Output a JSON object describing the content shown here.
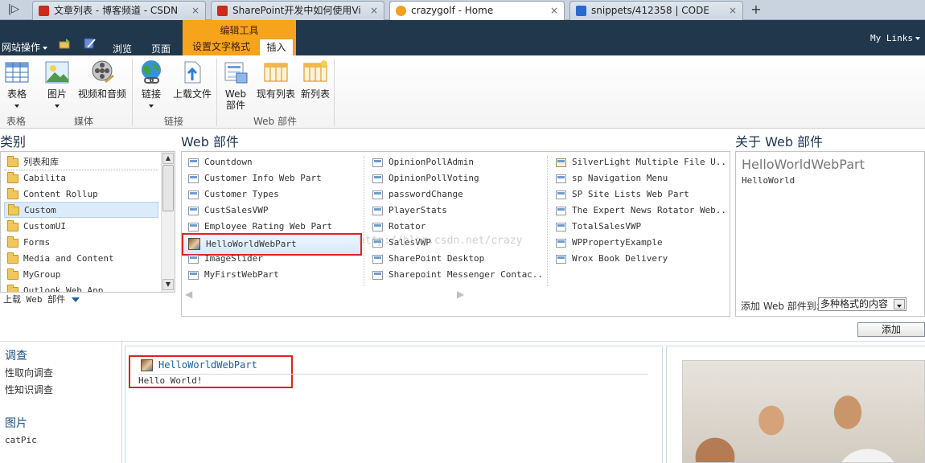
{
  "browser": {
    "tabs": [
      {
        "title": "文章列表 - 博客频道 - CSDN",
        "color": "#cc2a1a"
      },
      {
        "title": "SharePoint开发中如何使用Vi",
        "color": "#cc2a1a"
      },
      {
        "title": "crazygolf - Home",
        "color": "#f0a020"
      },
      {
        "title": "snippets/412358 | CODE",
        "color": "#2a6ad0"
      }
    ],
    "new_tab": "+",
    "close_glyph": "×"
  },
  "ribbon": {
    "site_actions": "网站操作",
    "browse": "浏览",
    "page": "页面",
    "context_group": "编辑工具",
    "tab_format": "设置文字格式",
    "tab_insert": "插入",
    "my_links": "My Links",
    "buttons": {
      "table": "表格",
      "picture": "图片",
      "video_audio": "视频和音频",
      "link": "链接",
      "upload_file": "上载文件",
      "web_part": "Web 部件",
      "existing_list": "现有列表",
      "new_list": "新列表"
    },
    "groups": {
      "tables": "表格",
      "media": "媒体",
      "links": "链接",
      "web_parts": "Web 部件"
    }
  },
  "categories": {
    "heading": "类别",
    "items": [
      "列表和库",
      "Cabilita",
      "Content Rollup",
      "Custom",
      "CustomUI",
      "Forms",
      "Media and Content",
      "MyGroup",
      "Outlook Web App"
    ],
    "selected": "Custom",
    "upload": "上载 Web 部件"
  },
  "webparts": {
    "heading": "Web 部件",
    "columns": [
      [
        "Countdown",
        "Customer Info Web Part",
        "Customer Types",
        "CustSalesVWP",
        "Employee Rating Web Part",
        "HelloWorldWebPart",
        "ImageSlider",
        "MyFirstWebPart"
      ],
      [
        "OpinionPollAdmin",
        "OpinionPollVoting",
        "passwordChange",
        "PlayerStats",
        "Rotator",
        "SalesVWP",
        "SharePoint Desktop",
        "Sharepoint Messenger Contac..."
      ],
      [
        "SilverLight Multiple File U...",
        "sp Navigation Menu",
        "SP Site Lists Web Part",
        "The Expert News Rotator Web...",
        "TotalSalesVWP",
        "WPPropertyExample",
        "Wrox Book Delivery"
      ]
    ],
    "selected": "HelloWorldWebPart",
    "watermark": "http://blog.csdn.net/crazy"
  },
  "about": {
    "heading": "关于 Web 部件",
    "title": "HelloWorldWebPart",
    "description": "HelloWorld",
    "add_to_label": "添加 Web 部件到:",
    "add_to_value": "多种格式的内容",
    "add_button": "添加"
  },
  "quicklaunch": {
    "survey_heading": "调查",
    "survey_items": [
      "性取向调查",
      "性知识调查"
    ],
    "pictures_heading": "图片",
    "pictures_items": [
      "catPic"
    ]
  },
  "content": {
    "webpart_title": "HelloWorldWebPart",
    "webpart_body": "Hello World!"
  }
}
